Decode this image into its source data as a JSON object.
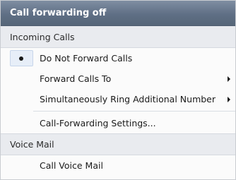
{
  "menu": {
    "title": "Call forwarding off",
    "sections": [
      {
        "label": "Incoming Calls",
        "items": [
          {
            "label": "Do Not Forward Calls",
            "selected": true,
            "submenu": false
          },
          {
            "label": "Forward Calls To",
            "selected": false,
            "submenu": true
          },
          {
            "label": "Simultaneously Ring Additional Number",
            "selected": false,
            "submenu": true
          },
          {
            "label": "Call-Forwarding Settings...",
            "selected": false,
            "submenu": false
          }
        ]
      },
      {
        "label": "Voice Mail",
        "items": [
          {
            "label": "Call Voice Mail",
            "selected": false,
            "submenu": false
          }
        ]
      }
    ]
  }
}
